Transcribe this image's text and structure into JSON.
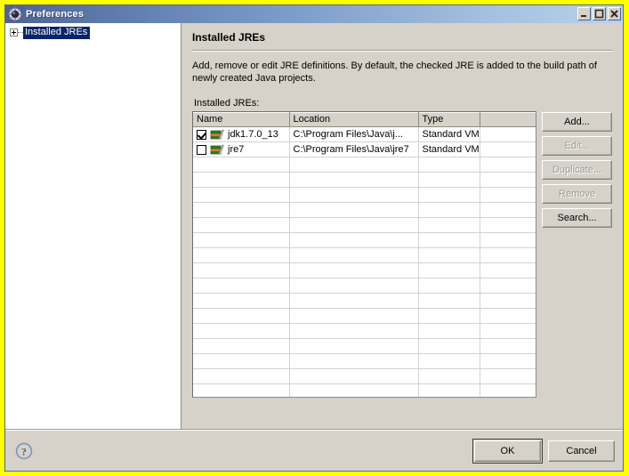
{
  "window": {
    "title": "Preferences",
    "icon": "gear-icon",
    "controls": {
      "minimize": "minimize-icon",
      "maximize": "maximize-icon",
      "close": "close-icon"
    },
    "frame_highlight_color": "#ffff00",
    "titlebar_gradient_from": "#4e6494",
    "titlebar_gradient_to": "#b9d2ea"
  },
  "sidebar": {
    "items": [
      {
        "label": "Installed JREs",
        "expander": "plus-box-icon",
        "selected": true
      }
    ],
    "selection_color": "#0a246a"
  },
  "page": {
    "title": "Installed JREs",
    "description": "Add, remove or edit JRE definitions. By default, the checked JRE is added to the build path of newly created Java projects.",
    "table_label": "Installed JREs:"
  },
  "table": {
    "columns": [
      "Name",
      "Location",
      "Type",
      ""
    ],
    "rows": [
      {
        "checked": true,
        "icon": "jre-books-icon",
        "name": "jdk1.7.0_13",
        "location": "C:\\Program Files\\Java\\j...",
        "type": "Standard VM",
        "extra": ""
      },
      {
        "checked": false,
        "icon": "jre-books-icon",
        "name": "jre7",
        "location": "C:\\Program Files\\Java\\jre7",
        "type": "Standard VM",
        "extra": ""
      }
    ],
    "empty_row_count": 16
  },
  "side_buttons": [
    {
      "label": "Add...",
      "enabled": true
    },
    {
      "label": "Edit...",
      "enabled": false
    },
    {
      "label": "Duplicate...",
      "enabled": false
    },
    {
      "label": "Remove",
      "enabled": false
    },
    {
      "label": "Search...",
      "enabled": true
    }
  ],
  "footer": {
    "help_icon": "help-circle-icon",
    "ok_label": "OK",
    "cancel_label": "Cancel",
    "default_button": "OK"
  }
}
